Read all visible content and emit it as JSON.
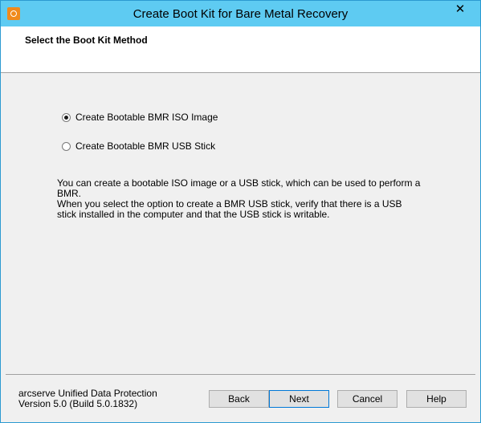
{
  "window": {
    "title": "Create Boot Kit for Bare Metal Recovery",
    "close_label": "✕"
  },
  "header": {
    "title": "Select the Boot Kit Method"
  },
  "options": [
    {
      "label": "Create Bootable BMR ISO Image",
      "selected": true
    },
    {
      "label": "Create Bootable BMR USB Stick",
      "selected": false
    }
  ],
  "description": {
    "line1": "You can create a bootable ISO image or a USB stick, which can be used to perform a BMR.",
    "line2": "When you select the option to create a BMR USB stick, verify that there is a USB stick installed in the computer and that the USB stick is writable."
  },
  "footer": {
    "product": "arcserve Unified Data Protection",
    "version": "Version 5.0 (Build 5.0.1832)"
  },
  "buttons": {
    "back": "Back",
    "next": "Next",
    "cancel": "Cancel",
    "help": "Help"
  }
}
